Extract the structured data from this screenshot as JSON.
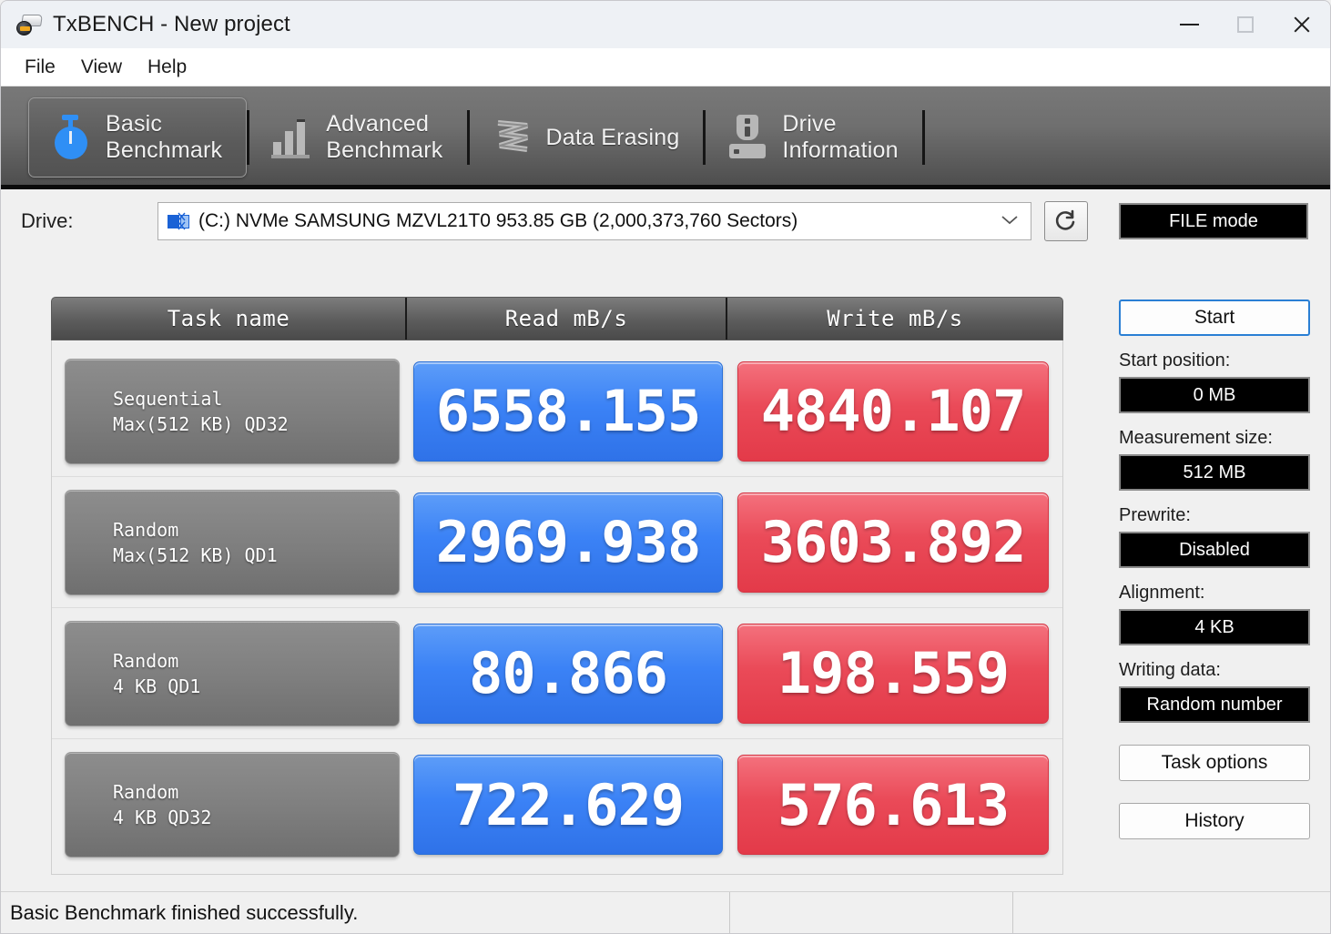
{
  "window": {
    "title": "TxBENCH - New project",
    "icon": "app-drive-icon",
    "minimize": "–",
    "maximize": "□",
    "close": "✕"
  },
  "menubar": {
    "items": [
      {
        "label": "File"
      },
      {
        "label": "View"
      },
      {
        "label": "Help"
      }
    ]
  },
  "tabs": [
    {
      "label": "Basic\nBenchmark",
      "icon": "stopwatch-icon",
      "active": true
    },
    {
      "label": "Advanced\nBenchmark",
      "icon": "bar-chart-icon",
      "active": false
    },
    {
      "label": "Data Erasing",
      "icon": "erase-zigzag-icon",
      "active": false
    },
    {
      "label": "Drive\nInformation",
      "icon": "drive-info-icon",
      "active": false
    }
  ],
  "drive_row": {
    "label": "Drive:",
    "icon": "disk-icon",
    "selected": "(C:) NVMe SAMSUNG MZVL21T0  953.85 GB (2,000,373,760 Sectors)",
    "dropdown_arrow": "⌄",
    "refresh_icon": "refresh-icon",
    "mode_button": "FILE mode"
  },
  "table": {
    "headers": {
      "task": "Task name",
      "read": "Read mB/s",
      "write": "Write mB/s"
    },
    "rows": [
      {
        "task_line1": "Sequential",
        "task_line2": "Max(512 KB) QD32",
        "read": "6558.155",
        "write": "4840.107"
      },
      {
        "task_line1": "Random",
        "task_line2": "Max(512 KB) QD1",
        "read": "2969.938",
        "write": "3603.892"
      },
      {
        "task_line1": "Random",
        "task_line2": "4 KB QD1",
        "read": "80.866",
        "write": "198.559"
      },
      {
        "task_line1": "Random",
        "task_line2": "4 KB QD32",
        "read": "722.629",
        "write": "576.613"
      }
    ]
  },
  "sidebar": {
    "start_button": "Start",
    "start_position_label": "Start position:",
    "start_position_value": "0 MB",
    "measurement_size_label": "Measurement size:",
    "measurement_size_value": "512 MB",
    "prewrite_label": "Prewrite:",
    "prewrite_value": "Disabled",
    "alignment_label": "Alignment:",
    "alignment_value": "4 KB",
    "writing_data_label": "Writing data:",
    "writing_data_value": "Random number",
    "task_options_button": "Task options",
    "history_button": "History"
  },
  "statusbar": {
    "message": "Basic Benchmark finished successfully."
  },
  "colors": {
    "read_accent": "#3b82f6",
    "write_accent": "#ea4a58",
    "tabbar_bg": "#6f6f6f",
    "value_box_bg": "#000000"
  }
}
